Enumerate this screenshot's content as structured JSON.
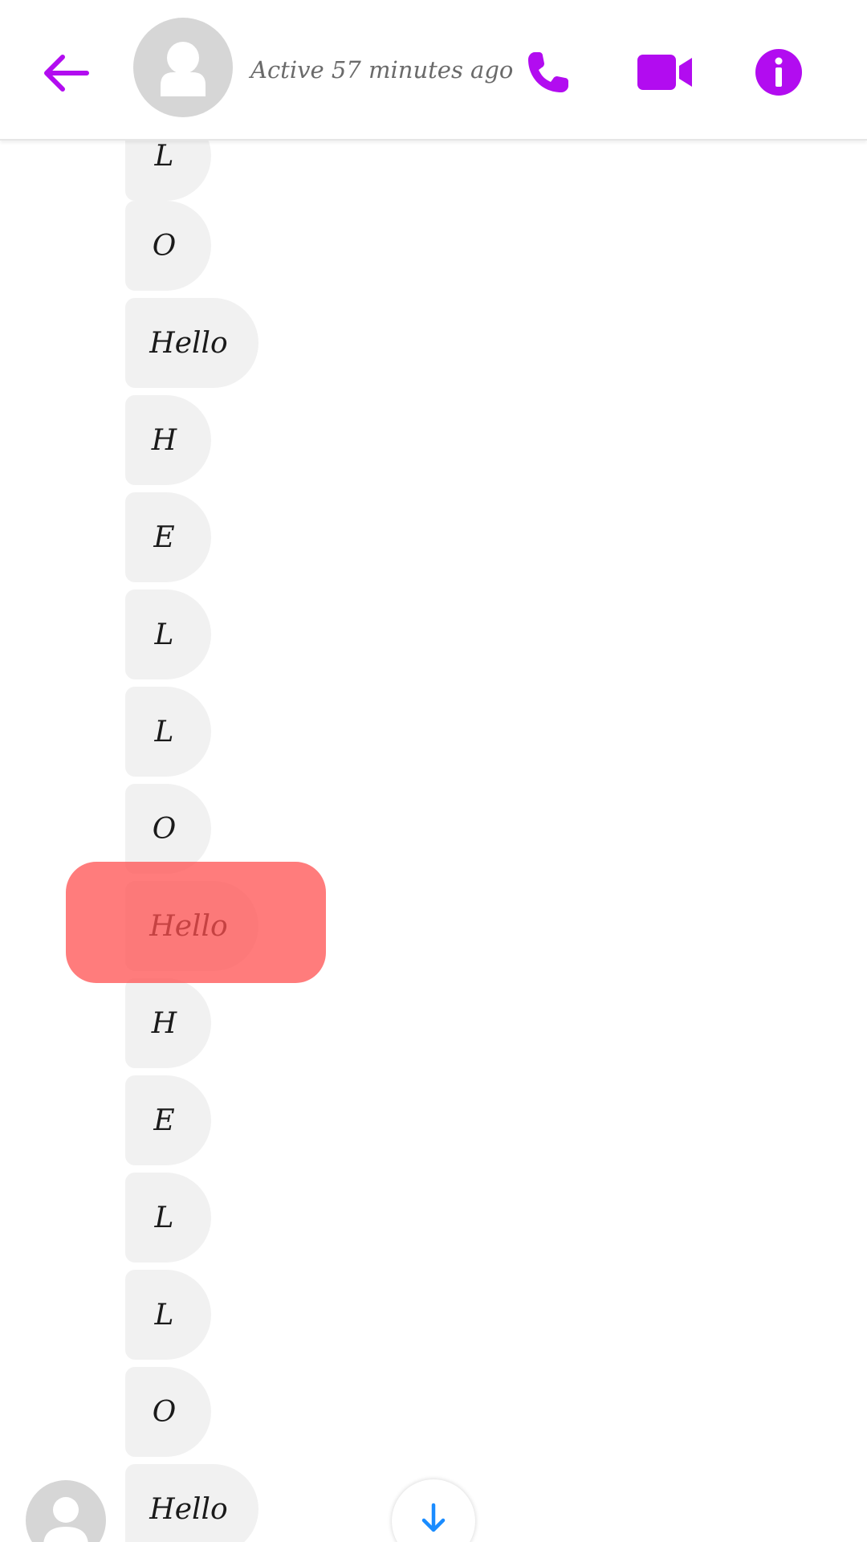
{
  "header": {
    "status": "Active 57 minutes ago",
    "back_icon": "arrow-left-icon",
    "call_icon": "phone-icon",
    "video_icon": "video-camera-icon",
    "info_icon": "info-icon",
    "accent_color": "#b20cf0"
  },
  "messages": [
    {
      "text": "L",
      "kind": "letter"
    },
    {
      "text": "O",
      "kind": "letter"
    },
    {
      "text": "Hello",
      "kind": "word"
    },
    {
      "text": "H",
      "kind": "letter"
    },
    {
      "text": "E",
      "kind": "letter"
    },
    {
      "text": "L",
      "kind": "letter"
    },
    {
      "text": "L",
      "kind": "letter"
    },
    {
      "text": "O",
      "kind": "letter"
    },
    {
      "text": "Hello",
      "kind": "word",
      "highlighted": true
    },
    {
      "text": "H",
      "kind": "letter"
    },
    {
      "text": "E",
      "kind": "letter"
    },
    {
      "text": "L",
      "kind": "letter"
    },
    {
      "text": "L",
      "kind": "letter"
    },
    {
      "text": "O",
      "kind": "letter"
    },
    {
      "text": "Hello",
      "kind": "word"
    }
  ],
  "highlight_color": "#ff5050",
  "scroll_down_icon": "arrow-down-icon",
  "scroll_down_color": "#1a8cff"
}
